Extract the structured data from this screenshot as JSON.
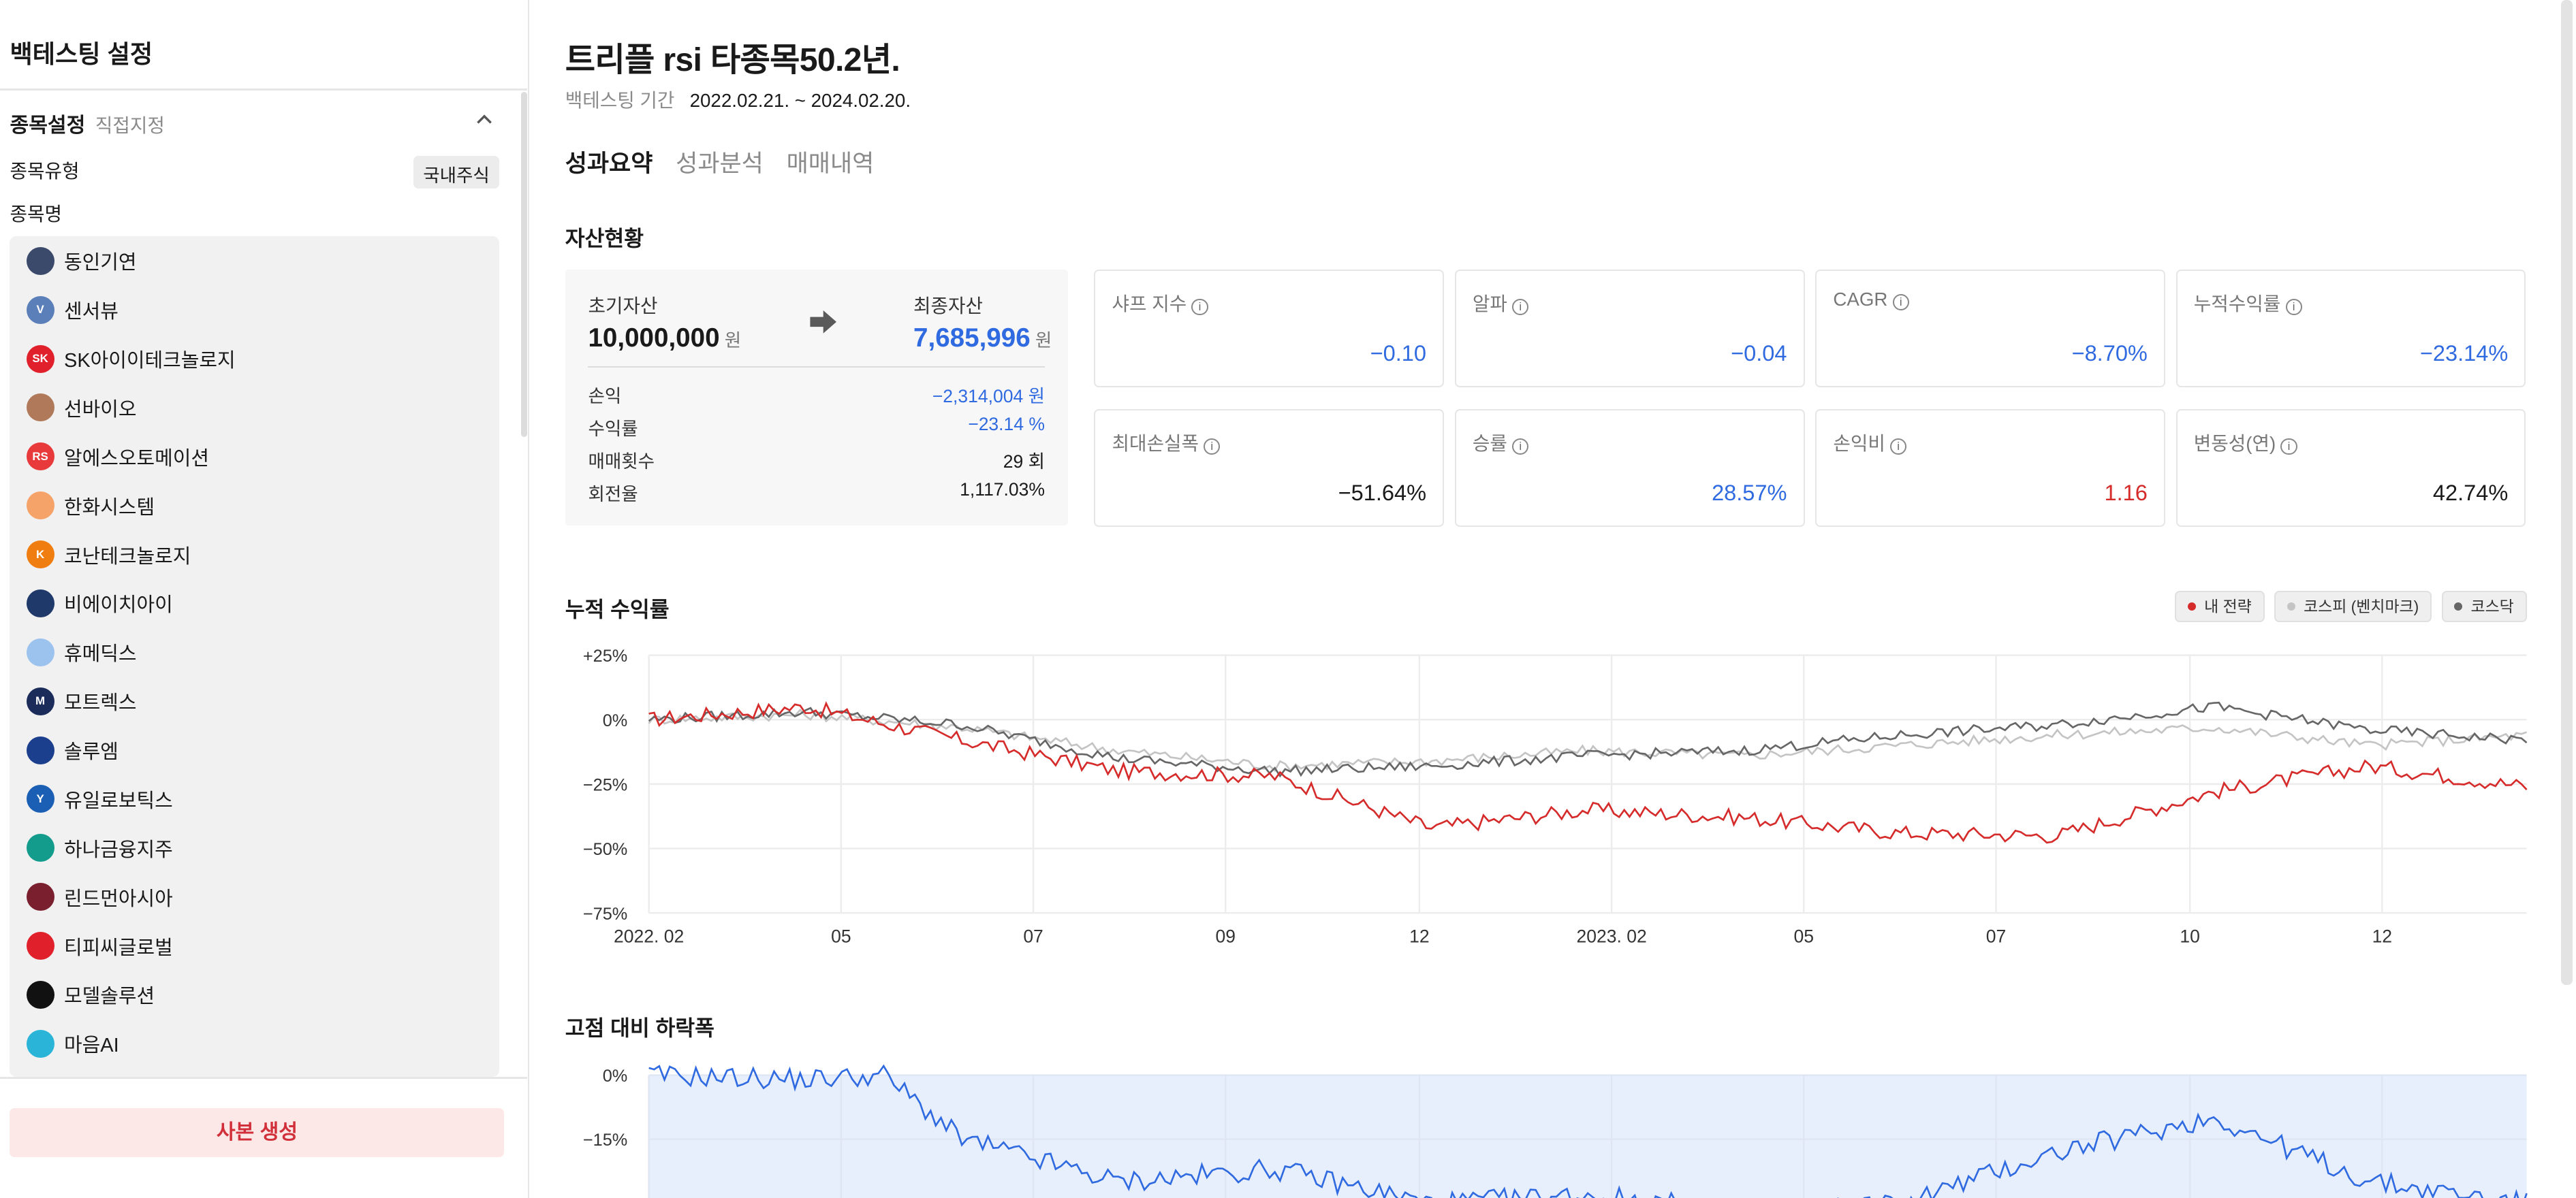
{
  "sidebar": {
    "title": "백테스팅 설정",
    "section_title": "종목설정",
    "section_sub": "직접지정",
    "type_label": "종목유형",
    "type_value": "국내주식",
    "name_label": "종목명",
    "stocks": [
      {
        "name": "동인기연",
        "logo_color": "#3b4a6b",
        "logo_text": ""
      },
      {
        "name": "센서뷰",
        "logo_color": "#5b7fb8",
        "logo_text": "V"
      },
      {
        "name": "SK아이이테크놀로지",
        "logo_color": "#e0202b",
        "logo_text": "SK"
      },
      {
        "name": "선바이오",
        "logo_color": "#b07a5a",
        "logo_text": ""
      },
      {
        "name": "알에스오토메이션",
        "logo_color": "#e83a3a",
        "logo_text": "RS"
      },
      {
        "name": "한화시스템",
        "logo_color": "#f6a36a",
        "logo_text": ""
      },
      {
        "name": "코난테크놀로지",
        "logo_color": "#f07d10",
        "logo_text": "K"
      },
      {
        "name": "비에이치아이",
        "logo_color": "#1f3a6a",
        "logo_text": ""
      },
      {
        "name": "휴메딕스",
        "logo_color": "#9cc2ee",
        "logo_text": ""
      },
      {
        "name": "모트렉스",
        "logo_color": "#1b2b5a",
        "logo_text": "M"
      },
      {
        "name": "솔루엠",
        "logo_color": "#1b3f8c",
        "logo_text": ""
      },
      {
        "name": "유일로보틱스",
        "logo_color": "#1a5fb4",
        "logo_text": "Y"
      },
      {
        "name": "하나금융지주",
        "logo_color": "#139b8c",
        "logo_text": ""
      },
      {
        "name": "린드먼아시아",
        "logo_color": "#7a1f2e",
        "logo_text": ""
      },
      {
        "name": "티피씨글로벌",
        "logo_color": "#e0202b",
        "logo_text": ""
      },
      {
        "name": "모델솔루션",
        "logo_color": "#111111",
        "logo_text": ""
      },
      {
        "name": "마음AI",
        "logo_color": "#2ab5d8",
        "logo_text": ""
      }
    ],
    "copy_button": "사본 생성"
  },
  "header": {
    "title": "트리플 rsi 타종목50.2년.",
    "period_label": "백테스팅 기간",
    "period_value": "2022.02.21. ~ 2024.02.20."
  },
  "tabs": [
    {
      "label": "성과요약",
      "active": true
    },
    {
      "label": "성과분석",
      "active": false
    },
    {
      "label": "매매내역",
      "active": false
    }
  ],
  "assets": {
    "section_title": "자산현황",
    "initial_label": "초기자산",
    "initial_value": "10,000,000",
    "won": "원",
    "final_label": "최종자산",
    "final_value": "7,685,996",
    "rows": [
      {
        "label": "손익",
        "value": "−2,314,004 원",
        "color": "#2f6ae0"
      },
      {
        "label": "수익률",
        "value": "−23.14 %",
        "color": "#2f6ae0"
      },
      {
        "label": "매매횟수",
        "value": "29 회",
        "color": "#1a1a1a"
      },
      {
        "label": "회전율",
        "value": "1,117.03%",
        "color": "#1a1a1a"
      }
    ]
  },
  "metrics": [
    {
      "label": "샤프 지수",
      "value": "−0.10",
      "color": "#2f6ae0"
    },
    {
      "label": "알파",
      "value": "−0.04",
      "color": "#2f6ae0"
    },
    {
      "label": "CAGR",
      "value": "−8.70%",
      "color": "#2f6ae0"
    },
    {
      "label": "누적수익률",
      "value": "−23.14%",
      "color": "#2f6ae0"
    },
    {
      "label": "최대손실폭",
      "value": "−51.64%",
      "color": "#1a1a1a"
    },
    {
      "label": "승률",
      "value": "28.57%",
      "color": "#2f6ae0"
    },
    {
      "label": "손익비",
      "value": "1.16",
      "color": "#d62b2b"
    },
    {
      "label": "변동성(연)",
      "value": "42.74%",
      "color": "#1a1a1a"
    }
  ],
  "cumulative_title": "누적 수익률",
  "legend": [
    {
      "label": "내 전략",
      "color": "#d62b2b"
    },
    {
      "label": "코스피 (벤치마크)",
      "color": "#c4c4c4"
    },
    {
      "label": "코스닥",
      "color": "#666666"
    }
  ],
  "drawdown_title": "고점 대비 하락폭",
  "chart_data": [
    {
      "type": "line",
      "title": "누적 수익률",
      "x_tick_labels": [
        "2022. 02",
        "05",
        "07",
        "09",
        "12",
        "2023. 02",
        "05",
        "07",
        "10",
        "12"
      ],
      "y_tick_labels": [
        "+25%",
        "0%",
        "−25%",
        "−50%",
        "−75%"
      ],
      "ylim": [
        -75,
        25
      ],
      "grid": true,
      "legend_position": "top-right",
      "x": [
        0,
        2,
        4,
        6,
        8,
        10,
        12,
        14,
        16,
        18,
        20,
        22,
        24
      ],
      "series": [
        {
          "name": "내 전략",
          "color": "#d62b2b",
          "values": [
            0,
            5,
            -8,
            -20,
            -22,
            -42,
            -35,
            -38,
            -44,
            -45,
            -28,
            -18,
            -26
          ]
        },
        {
          "name": "코스피 (벤치마크)",
          "color": "#c4c4c4",
          "values": [
            0,
            2,
            -3,
            -12,
            -18,
            -16,
            -12,
            -14,
            -10,
            -6,
            -3,
            -10,
            -6
          ]
        },
        {
          "name": "코스닥",
          "color": "#666666",
          "values": [
            0,
            3,
            -2,
            -15,
            -20,
            -18,
            -14,
            -12,
            -6,
            -2,
            5,
            -4,
            -8
          ]
        }
      ]
    },
    {
      "type": "area",
      "title": "고점 대비 하락폭",
      "y_tick_labels": [
        "0%",
        "−15%"
      ],
      "x": [
        0,
        2,
        3,
        4,
        6,
        8,
        10,
        12,
        14,
        16,
        18,
        20,
        22,
        24
      ],
      "series": [
        {
          "name": "내 전략",
          "color": "#2f6ae0",
          "values": [
            0,
            -1,
            0,
            -15,
            -25,
            -22,
            -30,
            -28,
            -32,
            -30,
            -18,
            -10,
            -25,
            -30
          ]
        }
      ]
    }
  ]
}
